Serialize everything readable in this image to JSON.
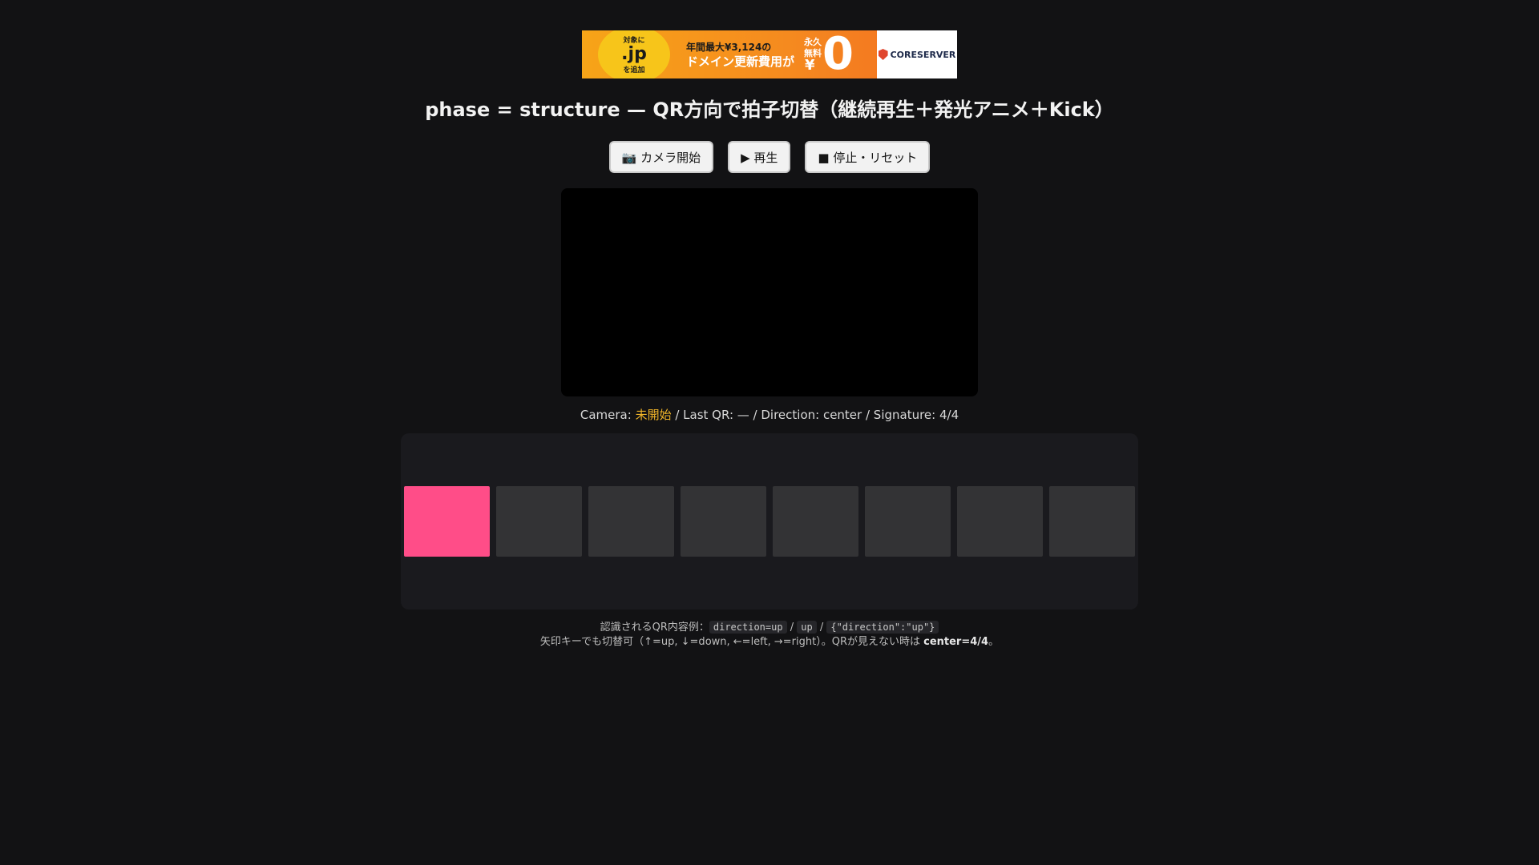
{
  "ad": {
    "target_small": "対象に",
    "jp": ".jp",
    "add_small": "を追加",
    "line1": "年間最大¥3,124の",
    "line2": "ドメイン更新費用が",
    "free": "永久無料",
    "yen": "¥",
    "zero": "0",
    "brand": "CORESERVER"
  },
  "title": "phase = structure — QR方向で拍子切替（継続再生＋発光アニメ＋Kick）",
  "controls": {
    "camera": "📷 カメラ開始",
    "play": "▶ 再生",
    "stop": "■ 停止・リセット"
  },
  "status": {
    "camera_label": "Camera: ",
    "camera_value": "未開始",
    "last_qr": " / Last QR: — / Direction: center / Signature: 4/4"
  },
  "steps": {
    "count": 8,
    "active_index": 0
  },
  "colors": {
    "active_step": "#ff4d88",
    "inactive_step": "#333335",
    "warn": "#f0b429"
  },
  "help": {
    "line1_prefix": "認識されるQR内容例：",
    "example1": "direction=up",
    "sep": " / ",
    "example2": "up",
    "example3": "{\"direction\":\"up\"}",
    "line2_prefix": "矢印キーでも切替可（↑=up, ↓=down, ←=left, →=right）。QRが見えない時は ",
    "line2_bold": "center=4/4",
    "line2_suffix": "。"
  }
}
